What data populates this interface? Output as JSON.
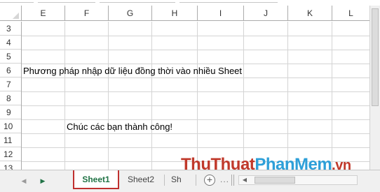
{
  "columns": [
    "E",
    "F",
    "G",
    "H",
    "I",
    "J",
    "K",
    "L"
  ],
  "rows": [
    "3",
    "4",
    "5",
    "6",
    "7",
    "8",
    "9",
    "10",
    "11",
    "12",
    "13"
  ],
  "cells": {
    "row6": "Phương pháp nhập dữ liệu đồng thời vào nhiều Sheet",
    "row10": "Chúc các bạn thành công!"
  },
  "tabs": [
    "Sheet1",
    "Sheet2",
    "Sh"
  ],
  "active_tab": "Sheet1",
  "add_symbol": "+",
  "overflow_dots": "...",
  "watermark": {
    "part1": "ThuThuat",
    "part2": "PhanMem",
    "part3": ".vn"
  },
  "colors": {
    "active_tab_border": "#c0302f",
    "active_tab_text": "#217346",
    "watermark_red": "#c0392b",
    "watermark_blue": "#2d9fd8"
  },
  "icons": {
    "nav_prev": "triangle-left-icon",
    "nav_next": "triangle-right-icon",
    "add_sheet": "plus-circle-icon"
  }
}
